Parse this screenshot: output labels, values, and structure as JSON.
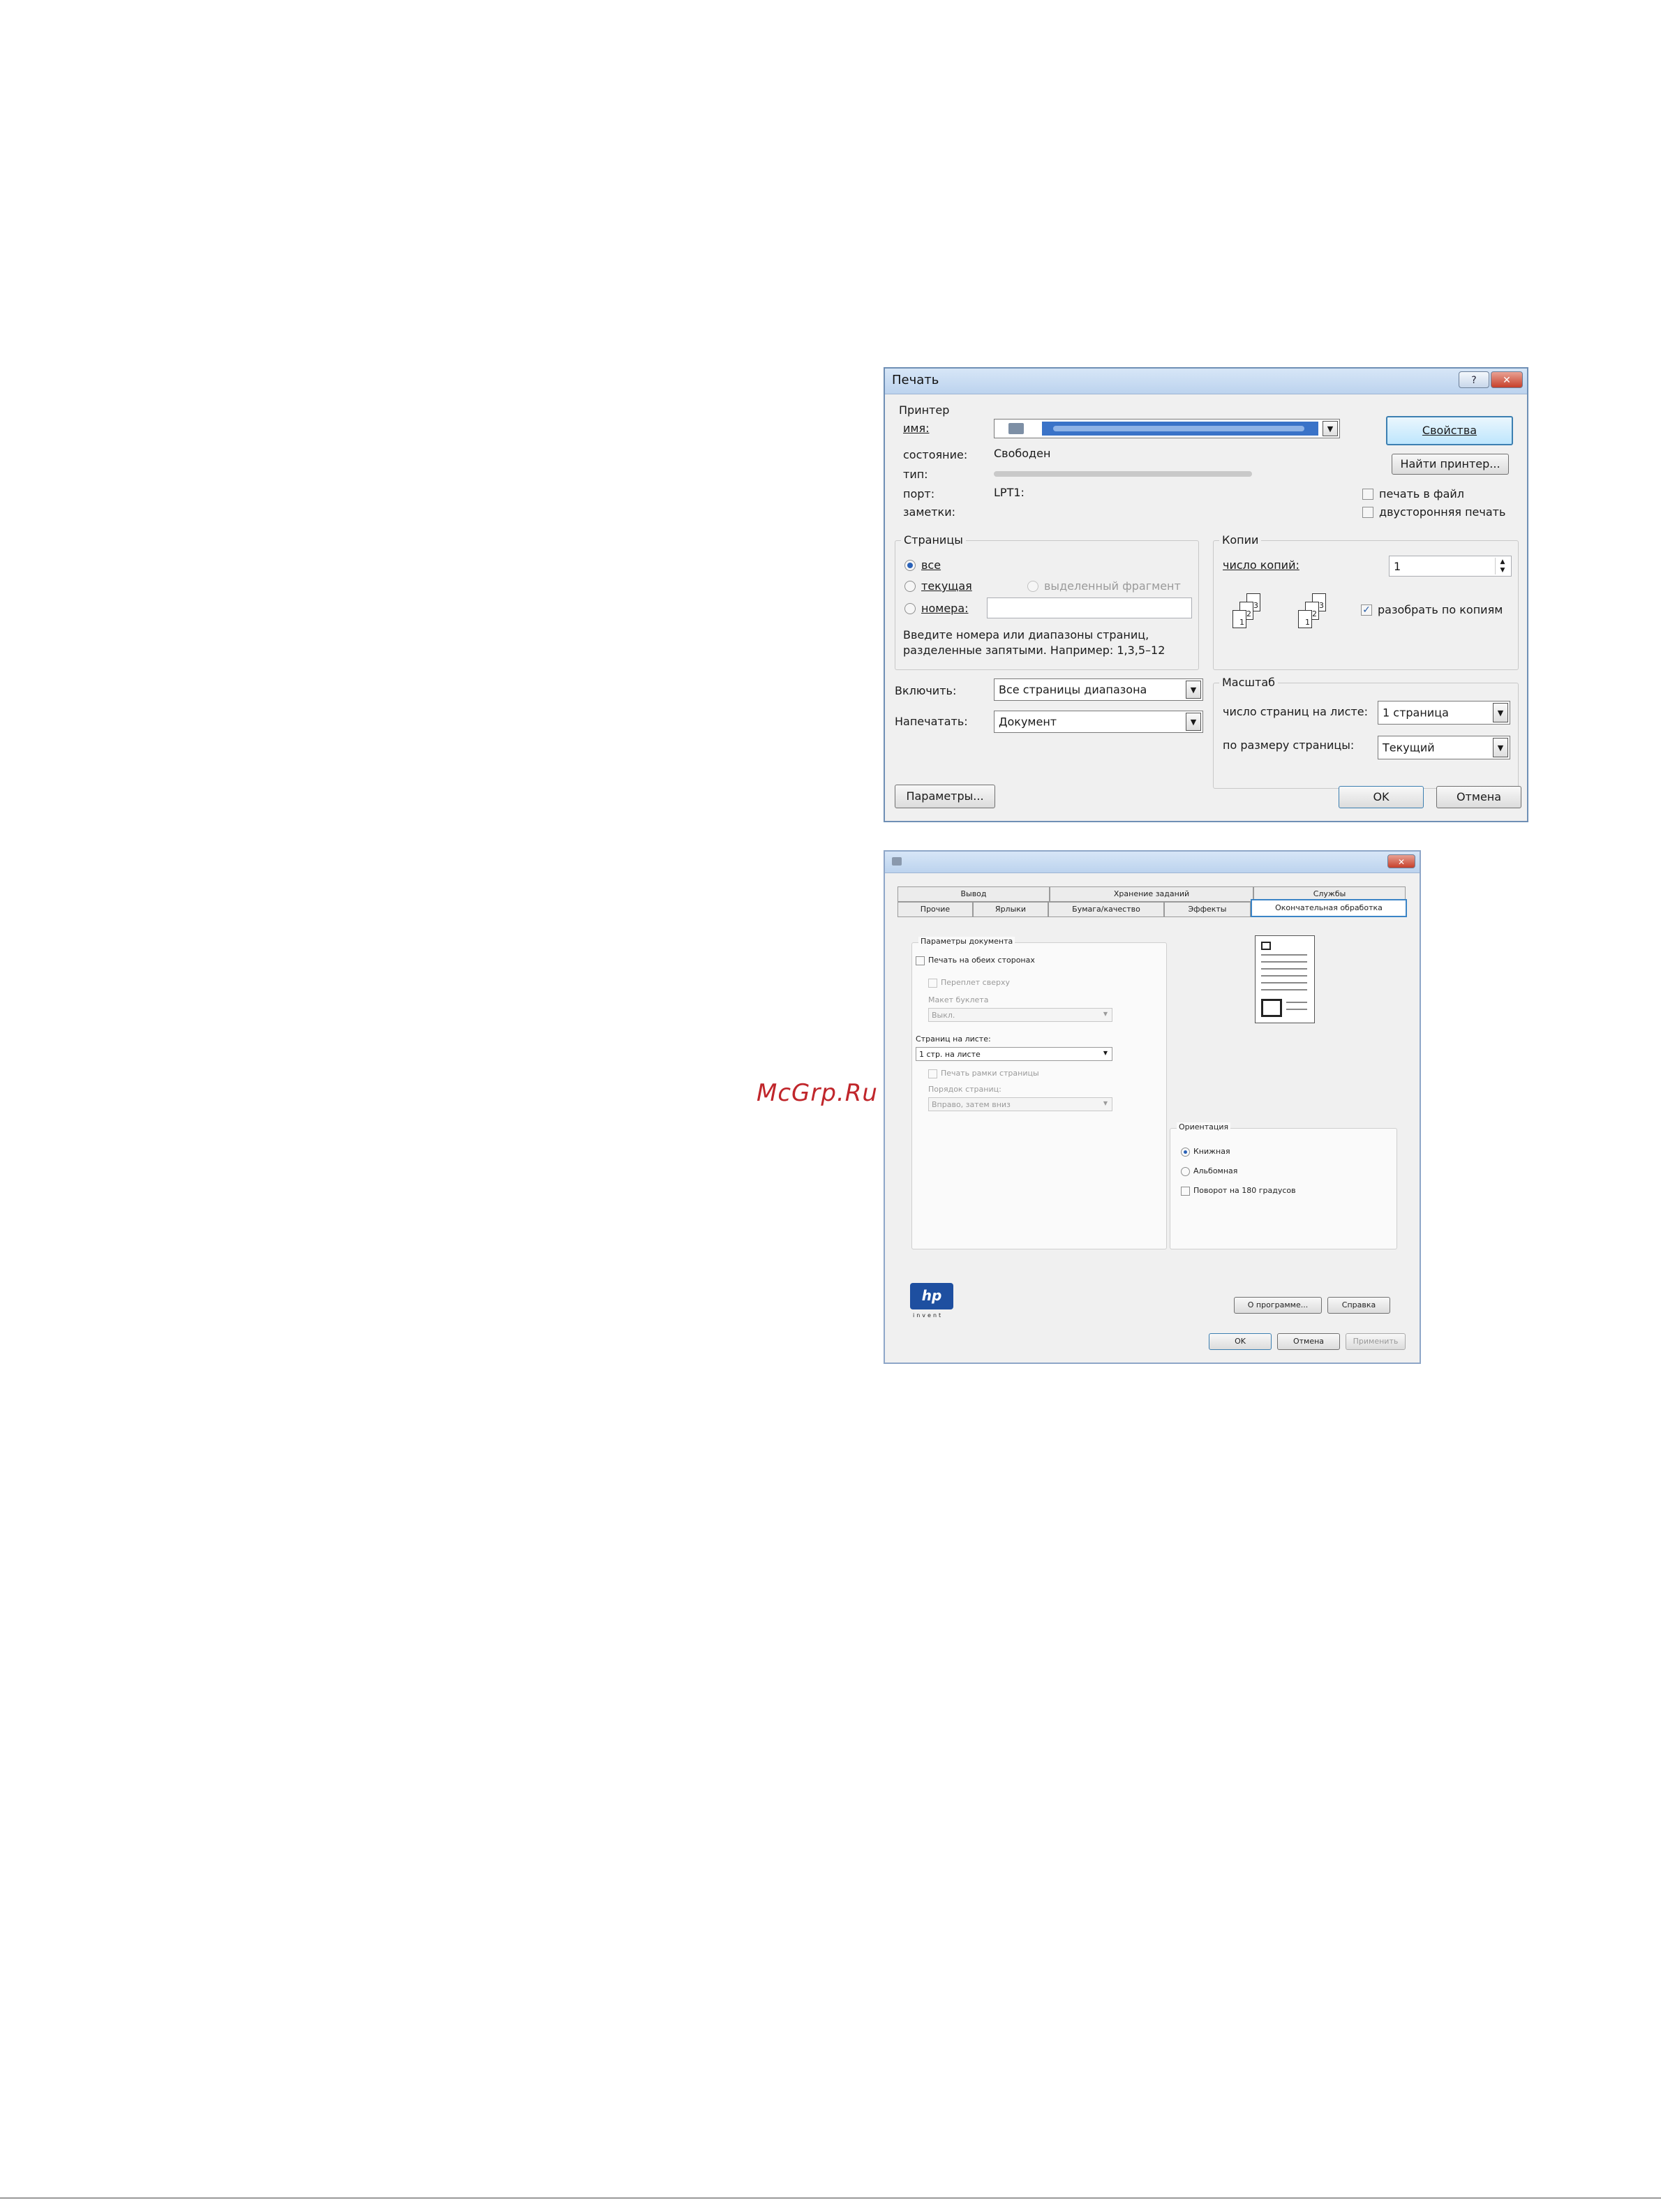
{
  "print_dialog": {
    "title": "Печать",
    "help_label": "?",
    "close_label": "✕",
    "printer": {
      "group_title": "Принтер",
      "name_label": "имя:",
      "status_label": "состояние:",
      "status_value": "Свободен",
      "type_label": "тип:",
      "port_label": "порт:",
      "port_value": "LPT1:",
      "notes_label": "заметки:",
      "properties_button": "Свойства",
      "find_printer_button": "Найти принтер...",
      "print_to_file_label": "печать в файл",
      "duplex_label": "двусторонняя печать"
    },
    "pages": {
      "group_title": "Страницы",
      "all_label": "все",
      "current_label": "текущая",
      "selection_label": "выделенный фрагмент",
      "numbers_label": "номера:",
      "hint_line1": "Введите номера или диапазоны страниц,",
      "hint_line2": "разделенные запятыми. Например: 1,3,5–12"
    },
    "copies": {
      "group_title": "Копии",
      "count_label": "число копий:",
      "count_value": "1",
      "collate_label": "разобрать по копиям",
      "stack_numbers": [
        "3",
        "2",
        "1"
      ]
    },
    "include_label": "Включить:",
    "include_value": "Все страницы диапазона",
    "print_what_label": "Напечатать:",
    "print_what_value": "Документ",
    "scale": {
      "group_title": "Масштаб",
      "pages_per_sheet_label": "число страниц на листе:",
      "pages_per_sheet_value": "1 страница",
      "scale_to_paper_label": "по размеру страницы:",
      "scale_to_paper_value": "Текущий"
    },
    "options_button": "Параметры...",
    "ok_button": "OK",
    "cancel_button": "Отмена"
  },
  "properties_dialog": {
    "close_label": "✕",
    "tabs_row1": [
      "Вывод",
      "Хранение заданий",
      "Службы"
    ],
    "tabs_row2": [
      "Прочие",
      "Ярлыки",
      "Бумага/качество",
      "Эффекты",
      "Окончательная обработка"
    ],
    "active_tab": "Окончательная обработка",
    "doc_options": {
      "group_title": "Параметры документа",
      "both_sides_label": "Печать на обеих сторонах",
      "flip_up_label": "Переплет сверху",
      "booklet_label": "Макет буклета",
      "booklet_value": "Выкл.",
      "pages_per_sheet_label": "Страниц на листе:",
      "pages_per_sheet_value": "1 стр. на листе",
      "borders_label": "Печать рамки страницы",
      "order_label": "Порядок страниц:",
      "order_value": "Вправо, затем вниз"
    },
    "orientation": {
      "group_title": "Ориентация",
      "portrait_label": "Книжная",
      "landscape_label": "Альбомная",
      "rotate_label": "Поворот на 180 градусов"
    },
    "logo_text": "hp",
    "logo_sub": "invent",
    "about_button": "О программе...",
    "help_button": "Справка",
    "ok_button": "OK",
    "cancel_button": "Отмена",
    "apply_button": "Применить"
  },
  "watermark": "McGrp.Ru",
  "colors": {
    "accent": "#3c7fb1",
    "watermark": "#c0262b",
    "selection": "#3a73c8"
  }
}
